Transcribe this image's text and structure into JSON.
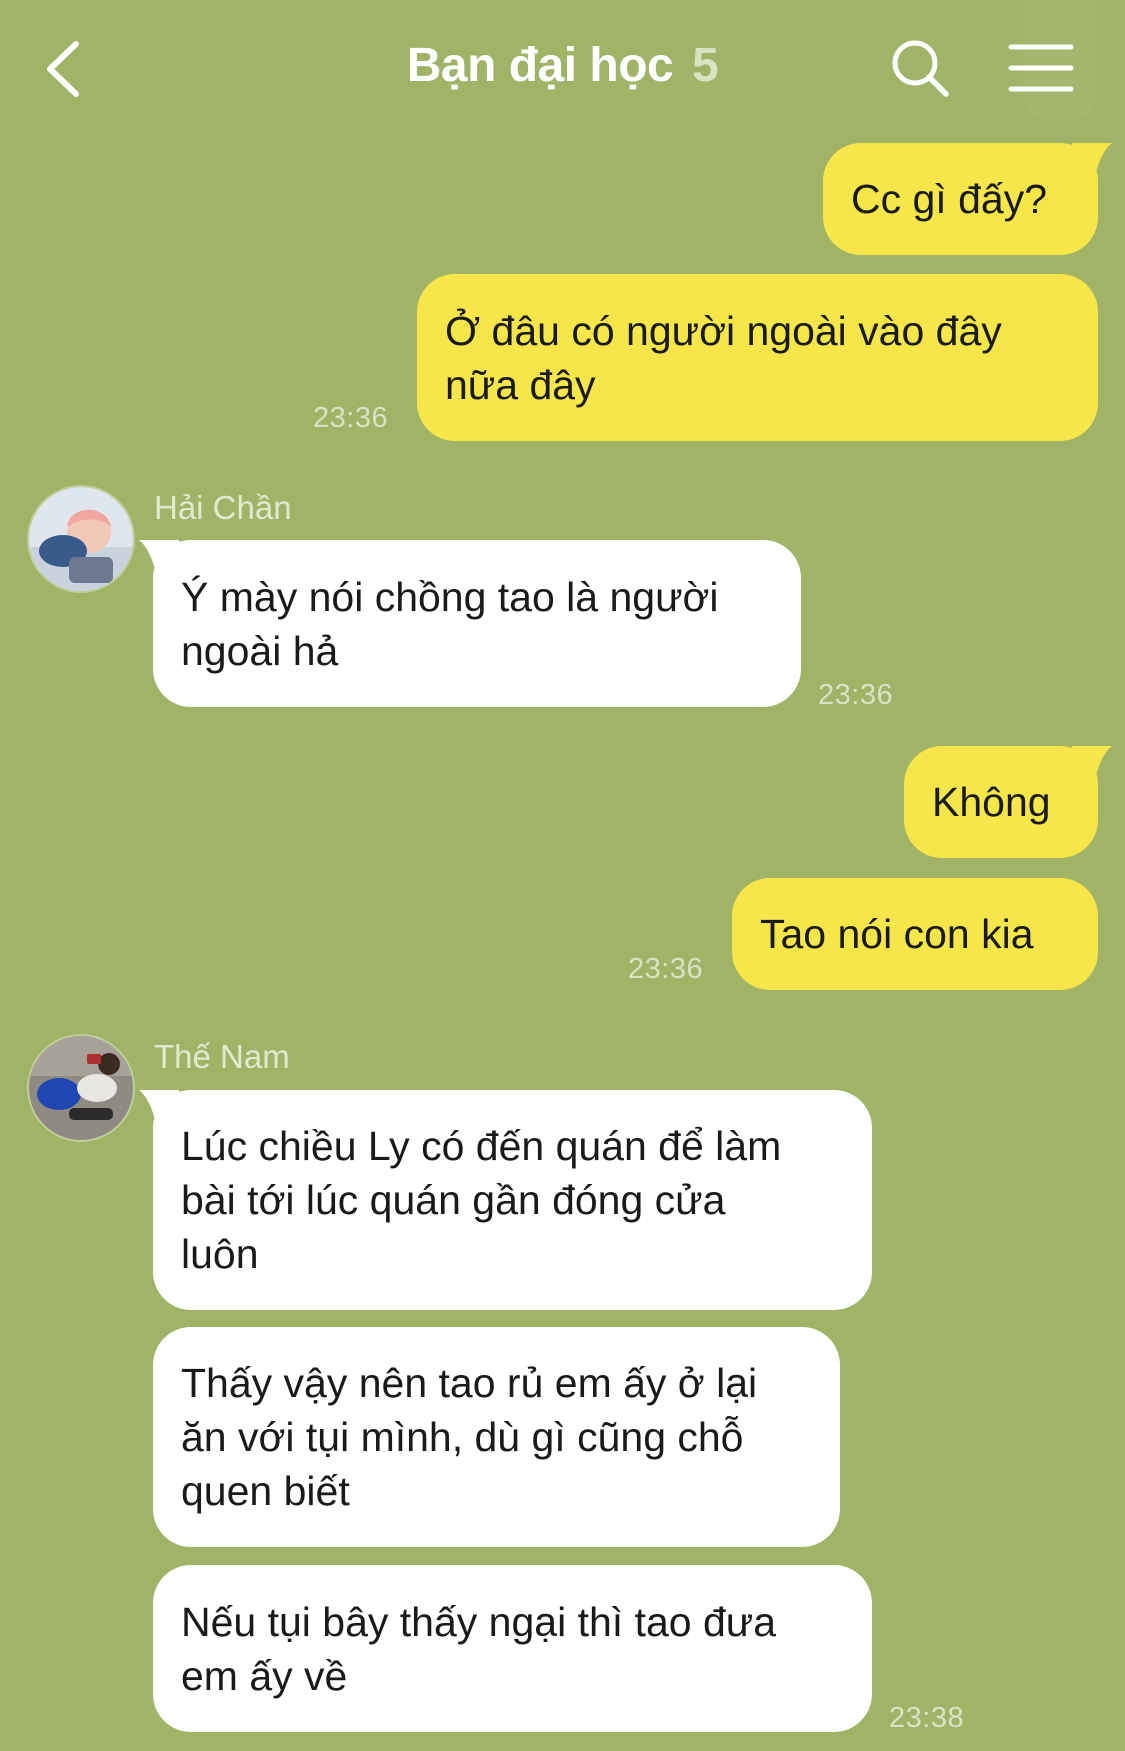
{
  "header": {
    "title": "Bạn đại học",
    "member_count": "5"
  },
  "messages": {
    "m1": {
      "text": "Cc gì đấy?"
    },
    "m2": {
      "text": "Ở đâu có người ngoài vào đây\nnữa đây",
      "time": "23:36"
    },
    "m3": {
      "sender": "Hải Chần",
      "text": "Ý mày nói chồng tao là người\nngoài hả",
      "time": "23:36"
    },
    "m4": {
      "text": "Không"
    },
    "m5": {
      "text": "Tao nói con kia",
      "time": "23:36"
    },
    "m6": {
      "sender": "Thế Nam",
      "text": "Lúc chiều Ly có đến quán để làm\nbài tới lúc quán gần đóng cửa\nluôn"
    },
    "m7": {
      "text": "Thấy vậy nên tao rủ em ấy ở lại\năn với tụi mình, dù gì cũng chỗ\nquen biết"
    },
    "m8": {
      "text": "Nếu tụi bây thấy ngại thì tao đưa\nem ấy về",
      "time": "23:38"
    }
  },
  "icons": {
    "back": "chevron-left-icon",
    "search": "search-icon",
    "menu": "hamburger-menu-icon"
  },
  "colors": {
    "background": "#a0b366",
    "outgoing_bubble": "#f7e64a",
    "incoming_bubble": "#ffffff",
    "timestamp": "#d9e2c4"
  }
}
